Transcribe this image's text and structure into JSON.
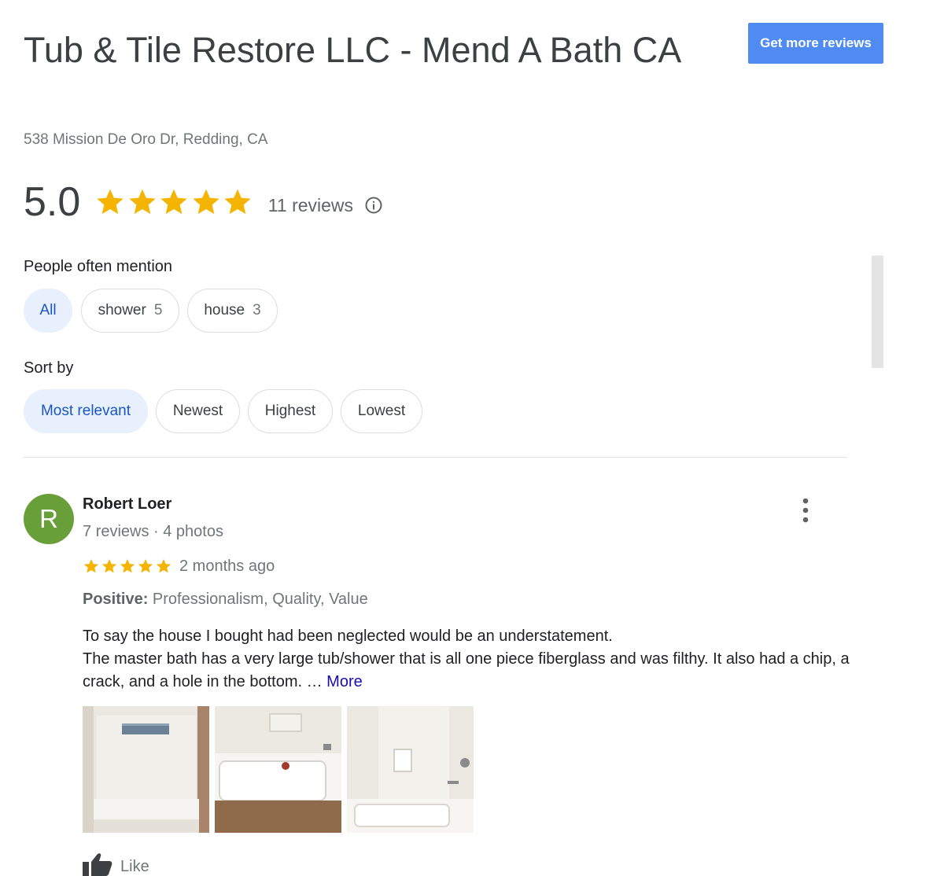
{
  "business": {
    "name": "Tub & Tile Restore LLC - Mend A Bath CA",
    "address": "538 Mission De Oro Dr, Redding, CA"
  },
  "cta": {
    "label": "Get more reviews"
  },
  "rating": {
    "score": "5.0",
    "stars": 5,
    "reviews_label": "11 reviews",
    "star_color": "#f4b400"
  },
  "mentions": {
    "label": "People often mention",
    "chips": [
      {
        "label": "All",
        "count": "",
        "selected": true
      },
      {
        "label": "shower",
        "count": "5",
        "selected": false
      },
      {
        "label": "house",
        "count": "3",
        "selected": false
      }
    ]
  },
  "sort": {
    "label": "Sort by",
    "options": [
      {
        "label": "Most relevant",
        "selected": true
      },
      {
        "label": "Newest",
        "selected": false
      },
      {
        "label": "Highest",
        "selected": false
      },
      {
        "label": "Lowest",
        "selected": false
      }
    ]
  },
  "review": {
    "avatar_letter": "R",
    "avatar_color": "#689f38",
    "author": "Robert Loer",
    "meta": "7 reviews · 4 photos",
    "stars": 5,
    "date": "2 months ago",
    "positive_label": "Positive:",
    "positive_values": "Professionalism, Quality, Value",
    "text_line1": "To say the house I bought had been neglected would be an understatement.",
    "text_line2": "The master bath has a very large tub/shower that is all one piece fiberglass and was filthy. It also had a chip, a crack, and a hole in the bottom. …",
    "more_label": "More",
    "photo_count": 3,
    "like_label": "Like"
  }
}
